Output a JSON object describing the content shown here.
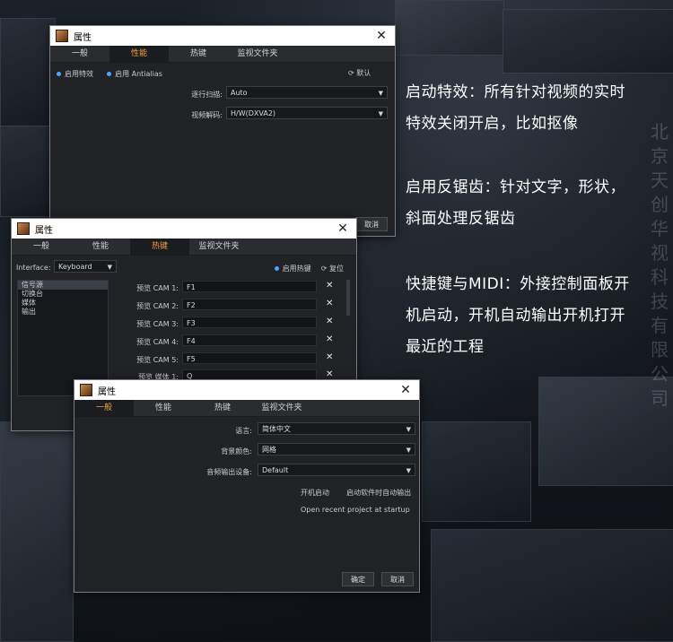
{
  "dialog1": {
    "title": "属性",
    "tabs": [
      "一般",
      "性能",
      "热键",
      "监视文件夹"
    ],
    "active_tab": "性能",
    "effects_label": "启用特效",
    "antialias_label": "启用 Antialias",
    "reset_label": "默认",
    "scan_label": "逐行扫描:",
    "scan_value": "Auto",
    "decode_label": "视频解码:",
    "decode_value": "H/W(DXVA2)",
    "cancel_label": "取消"
  },
  "dialog2": {
    "title": "属性",
    "tabs": [
      "一般",
      "性能",
      "热键",
      "监视文件夹"
    ],
    "active_tab": "热键",
    "interface_label": "Interface:",
    "interface_value": "Keyboard",
    "enable_hotkeys_label": "启用热键",
    "reset_label": "复位",
    "categories": [
      "信号源",
      "切换台",
      "媒体",
      "输出"
    ],
    "hotkeys": [
      {
        "label": "预览 CAM 1:",
        "key": "F1"
      },
      {
        "label": "预览 CAM 2:",
        "key": "F2"
      },
      {
        "label": "预览 CAM 3:",
        "key": "F3"
      },
      {
        "label": "预览 CAM 4:",
        "key": "F4"
      },
      {
        "label": "预览 CAM 5:",
        "key": "F5"
      },
      {
        "label": "预览 媒体 1:",
        "key": "Q"
      }
    ]
  },
  "dialog3": {
    "title": "属性",
    "tabs": [
      "一般",
      "性能",
      "热键",
      "监视文件夹"
    ],
    "active_tab": "一般",
    "language_label": "语言:",
    "language_value": "简体中文",
    "bg_color_label": "背景颜色:",
    "bg_color_value": "网格",
    "audio_label": "音频输出设备:",
    "audio_value": "Default",
    "startup_label": "开机启动",
    "auto_output_label": "启动软件时自动输出",
    "open_recent_label": "Open recent project at startup",
    "ok_label": "确定",
    "cancel_label": "取消"
  },
  "descriptions": {
    "effects_line1": "启动特效：所有针对视频的实时",
    "effects_line2": "特效关闭开启，比如抠像",
    "antialias_line1": "启用反锯齿：针对文字，形状，",
    "antialias_line2": "斜面处理反锯齿",
    "hotkey_line1": "快捷键与MIDI：外接控制面板开",
    "hotkey_line2": "机启动，开机自动输出开机打开",
    "hotkey_line3": "最近的工程"
  },
  "watermark": [
    "北",
    "京",
    "天",
    "创",
    "华",
    "视",
    "科",
    "技",
    "有",
    "限",
    "公",
    "司"
  ]
}
